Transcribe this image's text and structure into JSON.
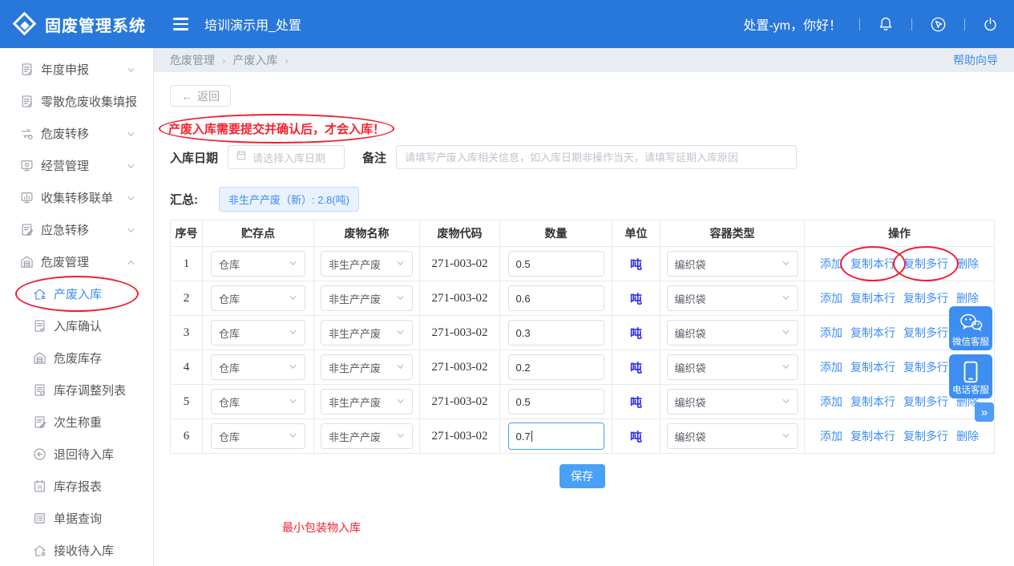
{
  "header": {
    "app_title": "固废管理系统",
    "workspace": "培训演示用_处置",
    "greeting": "处置-ym，你好！"
  },
  "sidebar": {
    "items": [
      {
        "label": "年度申报",
        "icon": "document-icon",
        "expanded": false
      },
      {
        "label": "零散危废收集填报",
        "icon": "document-icon",
        "expanded": false
      },
      {
        "label": "危废转移",
        "icon": "transfer-icon",
        "expanded": false
      },
      {
        "label": "经营管理",
        "icon": "monitor-icon",
        "expanded": false
      },
      {
        "label": "收集转移联单",
        "icon": "chart-icon",
        "expanded": false
      },
      {
        "label": "应急转移",
        "icon": "document-edit-icon",
        "expanded": false
      },
      {
        "label": "危废管理",
        "icon": "warehouse-icon",
        "expanded": true
      }
    ],
    "subitems": [
      {
        "label": "产废入库",
        "icon": "house-icon",
        "active": true,
        "circled": true
      },
      {
        "label": "入库确认",
        "icon": "document-check-icon"
      },
      {
        "label": "危废库存",
        "icon": "warehouse-icon"
      },
      {
        "label": "库存调整列表",
        "icon": "document-list-icon"
      },
      {
        "label": "次生称重",
        "icon": "document-edit-icon"
      },
      {
        "label": "退回待入库",
        "icon": "arrow-left-circle-icon"
      },
      {
        "label": "库存报表",
        "icon": "calendar-icon"
      },
      {
        "label": "单据查询",
        "icon": "list-icon"
      },
      {
        "label": "接收待入库",
        "icon": "house-icon"
      }
    ]
  },
  "breadcrumb": {
    "items": [
      "危废管理",
      "产废入库"
    ],
    "help": "帮助向导"
  },
  "page": {
    "back": {
      "arrow": "←",
      "label": "返回"
    },
    "warning": "产废入库需要提交并确认后，才会入库！",
    "form": {
      "date_label": "入库日期",
      "date_placeholder": "请选择入库日期",
      "remark_label": "备注",
      "remark_placeholder": "请填写产废入库相关信息，如入库日期非操作当天，请填写延期入库原因"
    },
    "summary": {
      "label": "汇总:",
      "badge": "非生产产废（新）: 2.8(吨)"
    },
    "table": {
      "headers": [
        "序号",
        "贮存点",
        "废物名称",
        "废物代码",
        "数量",
        "单位",
        "容器类型",
        "操作"
      ],
      "actions": [
        "添加",
        "复制本行",
        "复制多行",
        "删除"
      ],
      "rows": [
        {
          "no": "1",
          "storage": "仓库",
          "waste_name": "非生产产废",
          "waste_code": "271-003-02",
          "quantity": "0.5",
          "unit": "吨",
          "container": "编织袋",
          "circled": true
        },
        {
          "no": "2",
          "storage": "仓库",
          "waste_name": "非生产产废",
          "waste_code": "271-003-02",
          "quantity": "0.6",
          "unit": "吨",
          "container": "编织袋"
        },
        {
          "no": "3",
          "storage": "仓库",
          "waste_name": "非生产产废",
          "waste_code": "271-003-02",
          "quantity": "0.3",
          "unit": "吨",
          "container": "编织袋"
        },
        {
          "no": "4",
          "storage": "仓库",
          "waste_name": "非生产产废",
          "waste_code": "271-003-02",
          "quantity": "0.2",
          "unit": "吨",
          "container": "编织袋"
        },
        {
          "no": "5",
          "storage": "仓库",
          "waste_name": "非生产产废",
          "waste_code": "271-003-02",
          "quantity": "0.5",
          "unit": "吨",
          "container": "编织袋"
        },
        {
          "no": "6",
          "storage": "仓库",
          "waste_name": "非生产产废",
          "waste_code": "271-003-02",
          "quantity": "0.7",
          "unit": "吨",
          "container": "编织袋",
          "focused": true
        }
      ]
    },
    "save_label": "保存",
    "note": "最小包装物入库"
  },
  "floating": {
    "wechat": "微信客服",
    "phone": "电话客服",
    "expand": "»"
  },
  "colors": {
    "header_blue": "#2878db",
    "link_blue": "#3d8df5",
    "unit_blue": "#2d2df0",
    "annotation_red": "#ee1f30",
    "save_blue": "#4aa0f5",
    "badge_bg": "#e8f2fd"
  }
}
